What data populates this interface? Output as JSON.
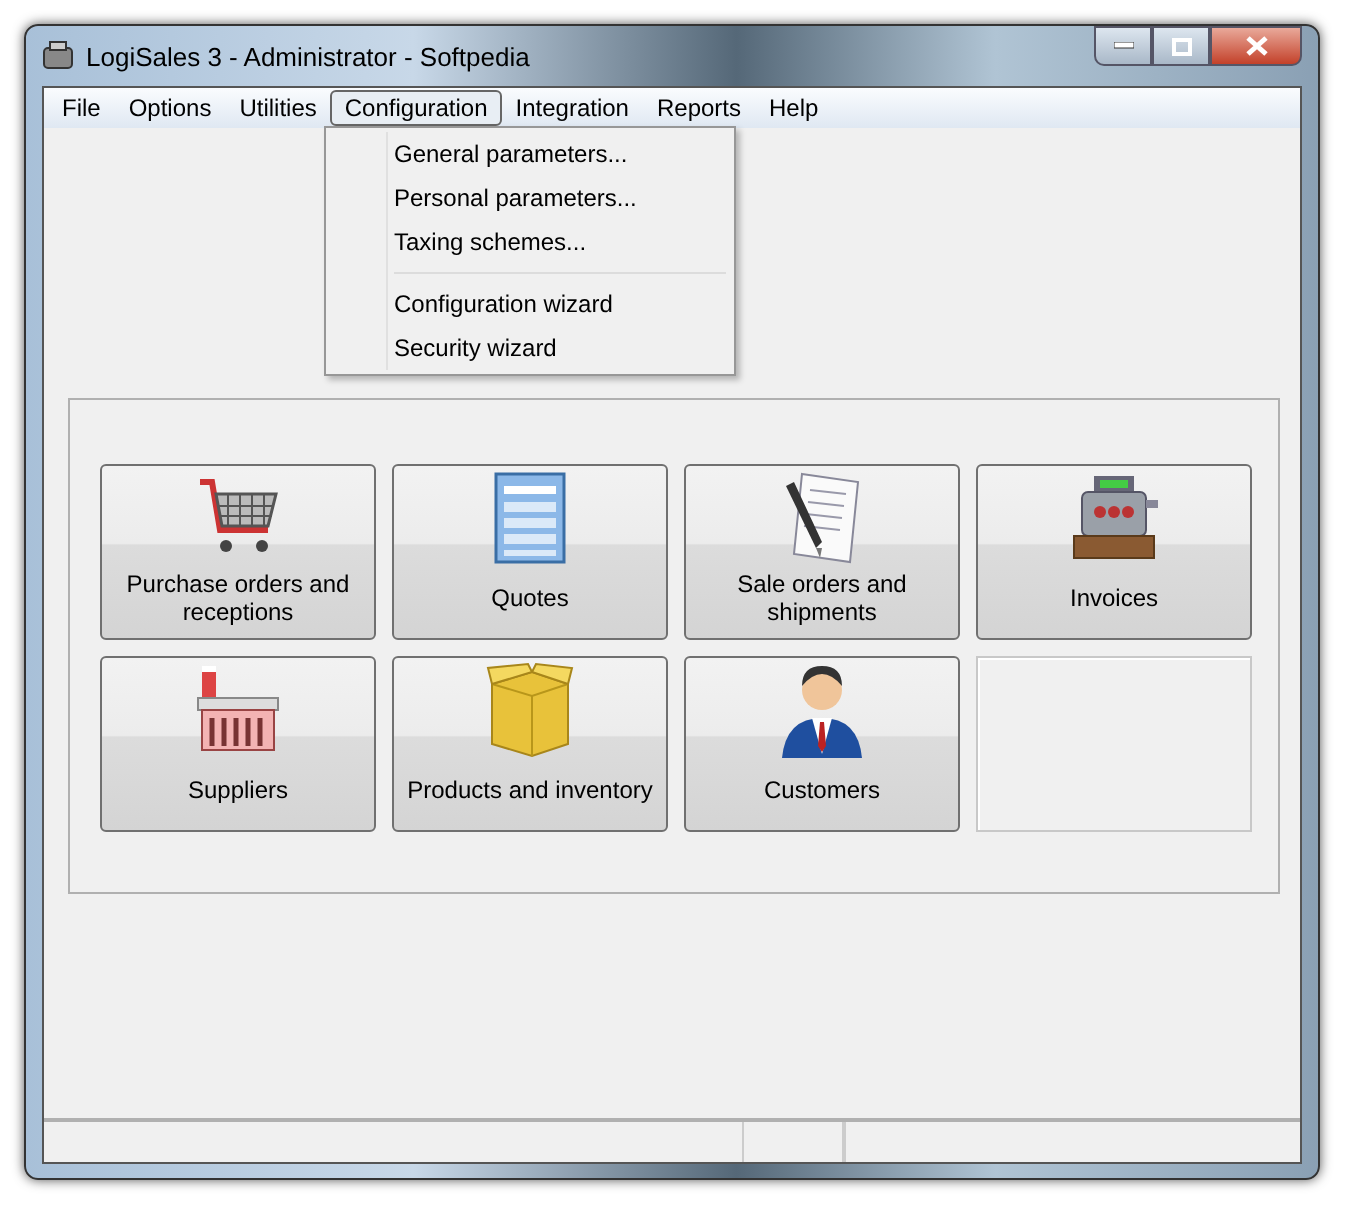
{
  "window": {
    "title": "LogiSales 3 - Administrator - Softpedia"
  },
  "menu_bar": [
    {
      "label": "File",
      "selected": false
    },
    {
      "label": "Options",
      "selected": false
    },
    {
      "label": "Utilities",
      "selected": false
    },
    {
      "label": "Configuration",
      "selected": true
    },
    {
      "label": "Integration",
      "selected": false
    },
    {
      "label": "Reports",
      "selected": false
    },
    {
      "label": "Help",
      "selected": false
    }
  ],
  "dropdown": {
    "groups": [
      [
        "General parameters...",
        "Personal parameters...",
        "Taxing schemes..."
      ],
      [
        "Configuration wizard",
        "Security wizard"
      ]
    ]
  },
  "tiles": [
    {
      "kind": "button",
      "label": "Purchase orders and receptions"
    },
    {
      "kind": "button",
      "label": "Quotes"
    },
    {
      "kind": "button",
      "label": "Sale orders and shipments"
    },
    {
      "kind": "button",
      "label": "Invoices"
    },
    {
      "kind": "button",
      "label": "Suppliers"
    },
    {
      "kind": "button",
      "label": "Products and inventory"
    },
    {
      "kind": "button",
      "label": "Customers"
    },
    {
      "kind": "empty"
    }
  ]
}
